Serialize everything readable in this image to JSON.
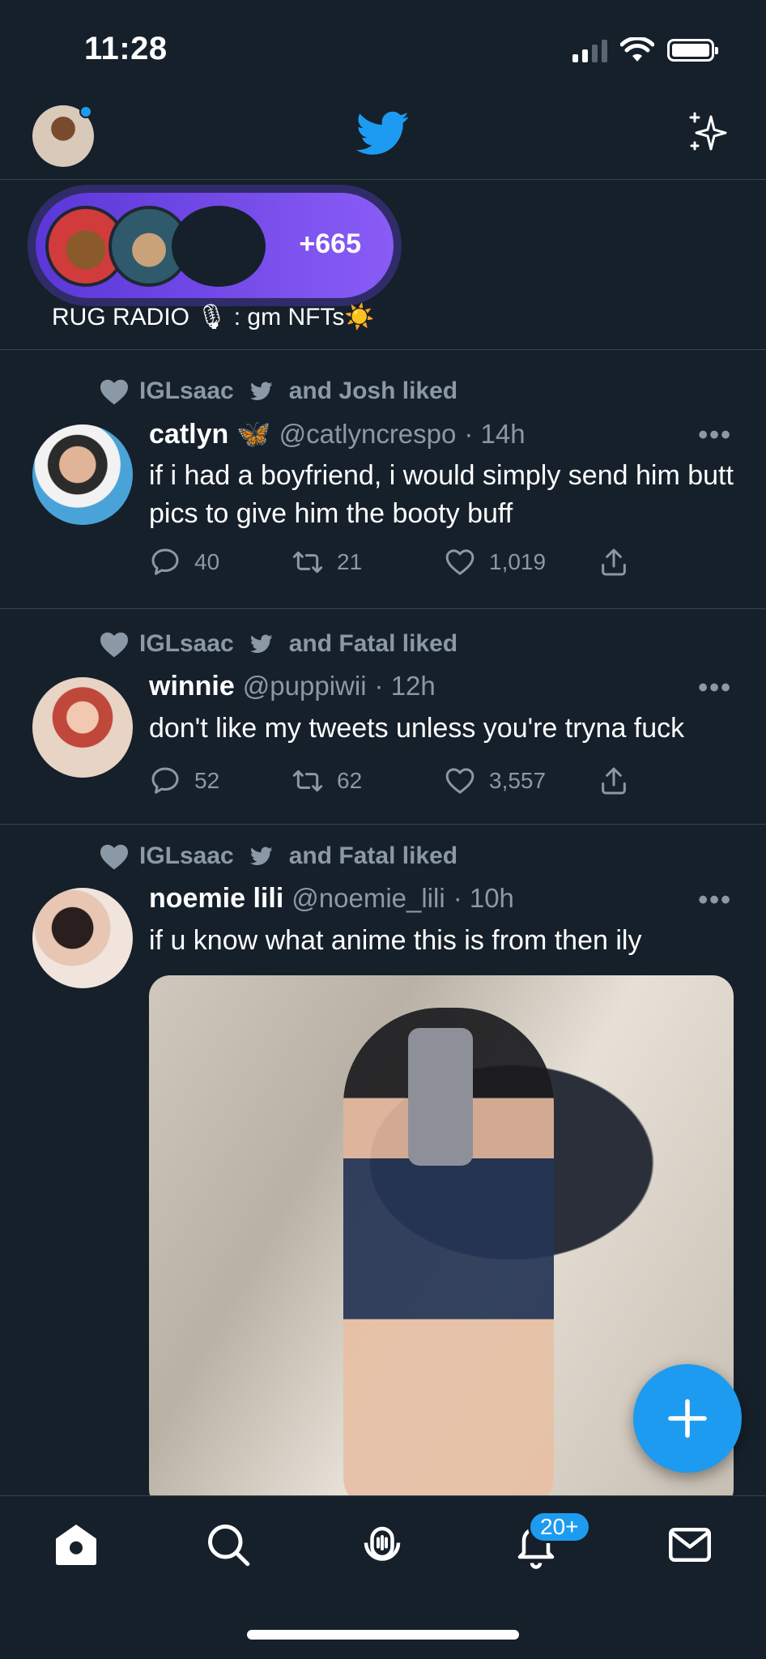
{
  "status_bar": {
    "time": "11:28"
  },
  "spaces": {
    "count": "+665",
    "title": "RUG RADIO 🎙 : gm NFTs☀️"
  },
  "tweets": [
    {
      "social_context": {
        "user": "IGLsaac",
        "text": "and Josh liked"
      },
      "name": "catlyn",
      "name_emoji": "🦋",
      "handle": "@catlyncrespo",
      "time": "· 14h",
      "text": "if i had a boyfriend, i would simply send him butt pics to give him the booty buff",
      "replies": "40",
      "retweets": "21",
      "likes": "1,019"
    },
    {
      "social_context": {
        "user": "IGLsaac",
        "text": "and Fatal liked"
      },
      "name": "winnie",
      "handle": "@puppiwii",
      "time": "· 12h",
      "text": "don't like my tweets unless you're tryna fuck",
      "replies": "52",
      "retweets": "62",
      "likes": "3,557"
    },
    {
      "social_context": {
        "user": "IGLsaac",
        "text": "and Fatal liked"
      },
      "name": "noemie lili",
      "handle": "@noemie_lili",
      "time": "· 10h",
      "text": "if u know what anime this is from then ily"
    }
  ],
  "bottom_nav": {
    "items": [
      "home-icon",
      "search-icon",
      "spaces-icon",
      "notifications-icon",
      "messages-icon"
    ],
    "notifications_badge": "20+"
  },
  "colors": {
    "background": "#15202b",
    "accent": "#1d9bf0",
    "secondary_text": "#8b98a5",
    "divider": "#38444d"
  }
}
